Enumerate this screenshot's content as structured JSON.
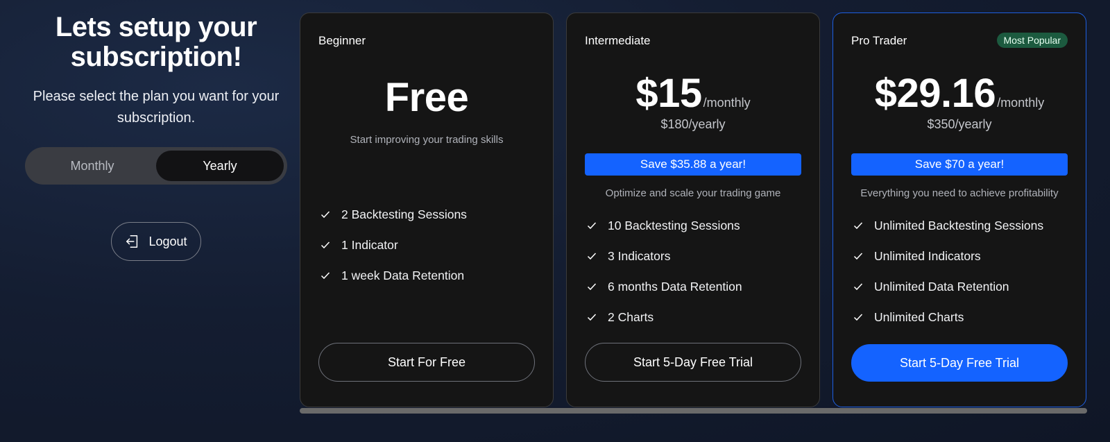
{
  "left": {
    "heading_line1": "Lets setup your",
    "heading_line2": "subscription!",
    "subtitle": "Please select the plan you want for your subscription.",
    "toggle": {
      "monthly": "Monthly",
      "yearly": "Yearly",
      "selected": "Yearly"
    },
    "logout_label": "Logout"
  },
  "plans": [
    {
      "name": "Beginner",
      "price": "Free",
      "description": "Start improving your trading skills",
      "features": [
        "2 Backtesting Sessions",
        "1 Indicator",
        "1 week Data Retention"
      ],
      "cta": "Start For Free"
    },
    {
      "name": "Intermediate",
      "price": "$15",
      "per": "/monthly",
      "yearly": "$180/yearly",
      "save": "Save $35.88 a year!",
      "description": "Optimize and scale your trading game",
      "features": [
        "10 Backtesting Sessions",
        "3 Indicators",
        "6 months Data Retention",
        "2 Charts"
      ],
      "cta": "Start 5-Day Free Trial"
    },
    {
      "name": "Pro Trader",
      "badge": "Most Popular",
      "price": "$29.16",
      "per": "/monthly",
      "yearly": "$350/yearly",
      "save": "Save $70 a year!",
      "description": "Everything you need to achieve profitability",
      "features": [
        "Unlimited Backtesting Sessions",
        "Unlimited Indicators",
        "Unlimited Data Retention",
        "Unlimited Charts"
      ],
      "cta": "Start 5-Day Free Trial"
    }
  ],
  "colors": {
    "accent": "#1463ff",
    "badge": "#1c5a3f",
    "card": "#151515"
  }
}
